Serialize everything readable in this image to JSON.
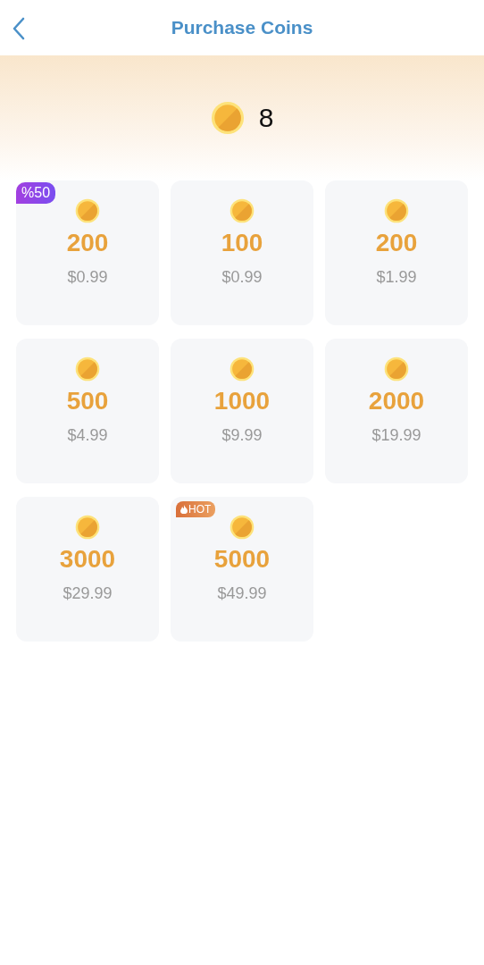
{
  "header": {
    "title": "Purchase Coins"
  },
  "balance": {
    "amount": "8"
  },
  "packages": [
    {
      "coins": "200",
      "price": "$0.99",
      "badge": {
        "kind": "discount",
        "label": "%50"
      }
    },
    {
      "coins": "100",
      "price": "$0.99"
    },
    {
      "coins": "200",
      "price": "$1.99"
    },
    {
      "coins": "500",
      "price": "$4.99"
    },
    {
      "coins": "1000",
      "price": "$9.99"
    },
    {
      "coins": "2000",
      "price": "$19.99"
    },
    {
      "coins": "3000",
      "price": "$29.99"
    },
    {
      "coins": "5000",
      "price": "$49.99",
      "badge": {
        "kind": "hot",
        "label": "HOT"
      }
    }
  ]
}
